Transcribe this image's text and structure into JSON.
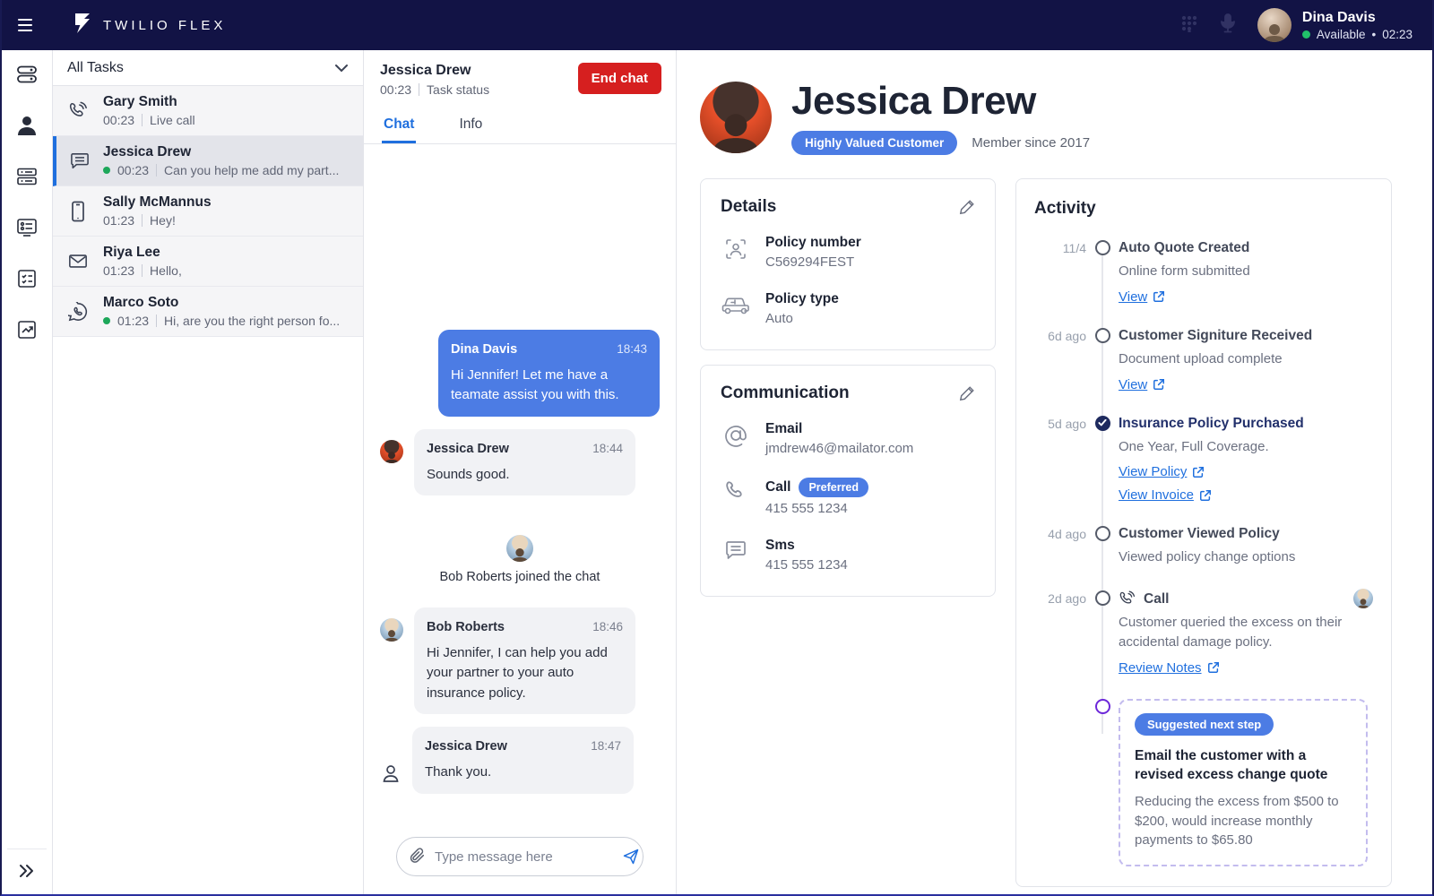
{
  "colors": {
    "navbar": "#121345",
    "accent_blue": "#1f6fde",
    "bubble_blue": "#4c7ce4",
    "danger_red": "#d61f1f",
    "success_green": "#21c06a",
    "done_navy": "#1e2a5e",
    "suggestion_purple": "#6d28d9"
  },
  "topbar": {
    "brand": "TWILIO FLEX",
    "user": {
      "name": "Dina Davis",
      "status": "Available",
      "separator": "•",
      "timer": "02:23"
    }
  },
  "sidebar": {
    "icons": [
      "toggles",
      "agent-person",
      "task-list",
      "queue-card",
      "checklist",
      "insights-chart"
    ],
    "collapse": "expand-rail"
  },
  "tasks": {
    "filter_label": "All Tasks",
    "items": [
      {
        "name": "Gary Smith",
        "time": "00:23",
        "preview": "Live call",
        "channel": "voice",
        "online": false,
        "selected": false
      },
      {
        "name": "Jessica Drew",
        "time": "00:23",
        "preview": "Can you help me add my part...",
        "channel": "chat",
        "online": true,
        "selected": true
      },
      {
        "name": "Sally McMannus",
        "time": "01:23",
        "preview": "Hey!",
        "channel": "mobile",
        "online": false,
        "selected": false
      },
      {
        "name": "Riya Lee",
        "time": "01:23",
        "preview": "Hello,",
        "channel": "email",
        "online": false,
        "selected": false
      },
      {
        "name": "Marco Soto",
        "time": "01:23",
        "preview": "Hi, are you the right person fo...",
        "channel": "whatsapp",
        "online": true,
        "selected": false
      }
    ]
  },
  "chat": {
    "header": {
      "name": "Jessica Drew",
      "time": "00:23",
      "status": "Task status",
      "end_button": "End chat"
    },
    "tabs": [
      {
        "label": "Chat"
      },
      {
        "label": "Info"
      }
    ],
    "messages": [
      {
        "type": "outbound",
        "author": "Dina Davis",
        "time": "18:43",
        "text": "Hi Jennifer! Let me have a teamate assist you with this."
      },
      {
        "type": "inbound",
        "author": "Jessica Drew",
        "time": "18:44",
        "text": "Sounds good."
      },
      {
        "type": "system",
        "text": "Bob Roberts joined the chat"
      },
      {
        "type": "inbound",
        "author": "Bob Roberts",
        "time": "18:46",
        "text": "Hi Jennifer, I can help you add your partner to your auto insurance policy."
      },
      {
        "type": "inbound",
        "author": "Jessica Drew",
        "time": "18:47",
        "text": "Thank you."
      }
    ],
    "input_placeholder": "Type message here"
  },
  "profile": {
    "name": "Jessica Drew",
    "badge": "Highly Valued Customer",
    "member_since": "Member since 2017",
    "details": {
      "title": "Details",
      "rows": [
        {
          "icon": "id-scan",
          "label": "Policy number",
          "value": "C569294FEST"
        },
        {
          "icon": "car",
          "label": "Policy type",
          "value": "Auto"
        }
      ]
    },
    "communication": {
      "title": "Communication",
      "rows": [
        {
          "icon": "at-sign",
          "label": "Email",
          "value": "jmdrew46@mailator.com"
        },
        {
          "icon": "phone",
          "label": "Call",
          "pill": "Preferred",
          "value": "415 555 1234"
        },
        {
          "icon": "sms-bubble",
          "label": "Sms",
          "value": "415 555 1234"
        }
      ]
    }
  },
  "activity": {
    "title": "Activity",
    "events": [
      {
        "date": "11/4",
        "state": "open",
        "title": "Auto Quote Created",
        "desc": "Online form submitted",
        "links": [
          "View"
        ]
      },
      {
        "date": "6d ago",
        "state": "open",
        "title": "Customer Signiture Received",
        "desc": "Document upload complete",
        "links": [
          "View"
        ]
      },
      {
        "date": "5d ago",
        "state": "done",
        "title": "Insurance Policy Purchased",
        "desc": "One Year, Full Coverage.",
        "links": [
          "View Policy",
          "View Invoice"
        ]
      },
      {
        "date": "4d ago",
        "state": "open",
        "title": "Customer Viewed Policy",
        "desc": "Viewed policy change options",
        "links": []
      },
      {
        "date": "2d ago",
        "state": "open",
        "title": "Call",
        "title_icon": "phone",
        "desc": "Customer queried the excess on their accidental damage policy.",
        "links": [
          "Review Notes"
        ]
      }
    ],
    "suggestion": {
      "pill": "Suggested next step",
      "title": "Email the customer with a revised excess change quote",
      "desc": "Reducing the excess from $500 to $200, would increase monthly payments to $65.80"
    }
  }
}
